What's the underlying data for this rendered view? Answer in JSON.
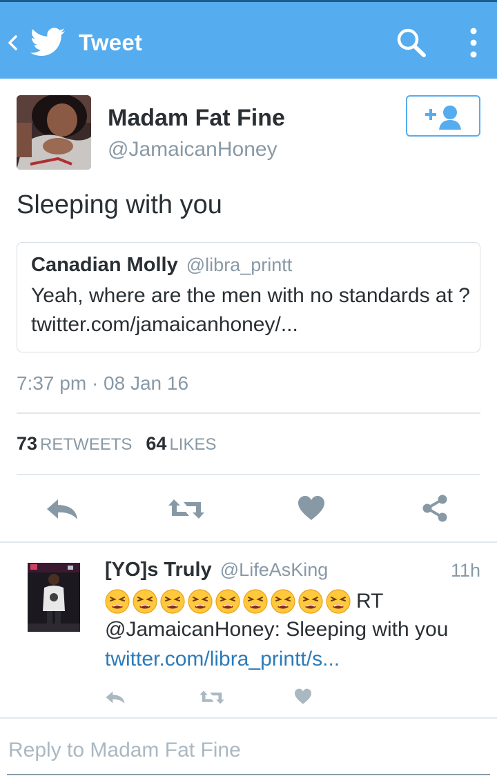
{
  "header": {
    "title": "Tweet",
    "background_color": "#55acee"
  },
  "tweet": {
    "author_name": "Madam Fat Fine",
    "author_handle": "@JamaicanHoney",
    "text": "Sleeping with you",
    "quoted": {
      "author_name": "Canadian Molly",
      "author_handle": "@libra_printt",
      "text": "Yeah, where are the men with no standards at ? twitter.com/jamaicanhoney/..."
    },
    "timestamp": "7:37 pm · 08 Jan 16",
    "retweet_count": "73",
    "retweet_label": "RETWEETS",
    "like_count": "64",
    "like_label": "LIKES"
  },
  "reply": {
    "author_name": "[YO]s Truly",
    "author_handle": "@LifeAsKing",
    "time": "11h",
    "emoji_count": 9,
    "emoji_name": "tired-face-emoji",
    "rt_text": "RT",
    "line2": "@JamaicanHoney: Sleeping with you",
    "link": "twitter.com/libra_printt/s..."
  },
  "compose": {
    "placeholder": "Reply to Madam Fat Fine"
  },
  "colors": {
    "accent": "#55acee",
    "muted": "#8899a6",
    "icon": "#8899a6",
    "link": "#2b7bb9"
  }
}
